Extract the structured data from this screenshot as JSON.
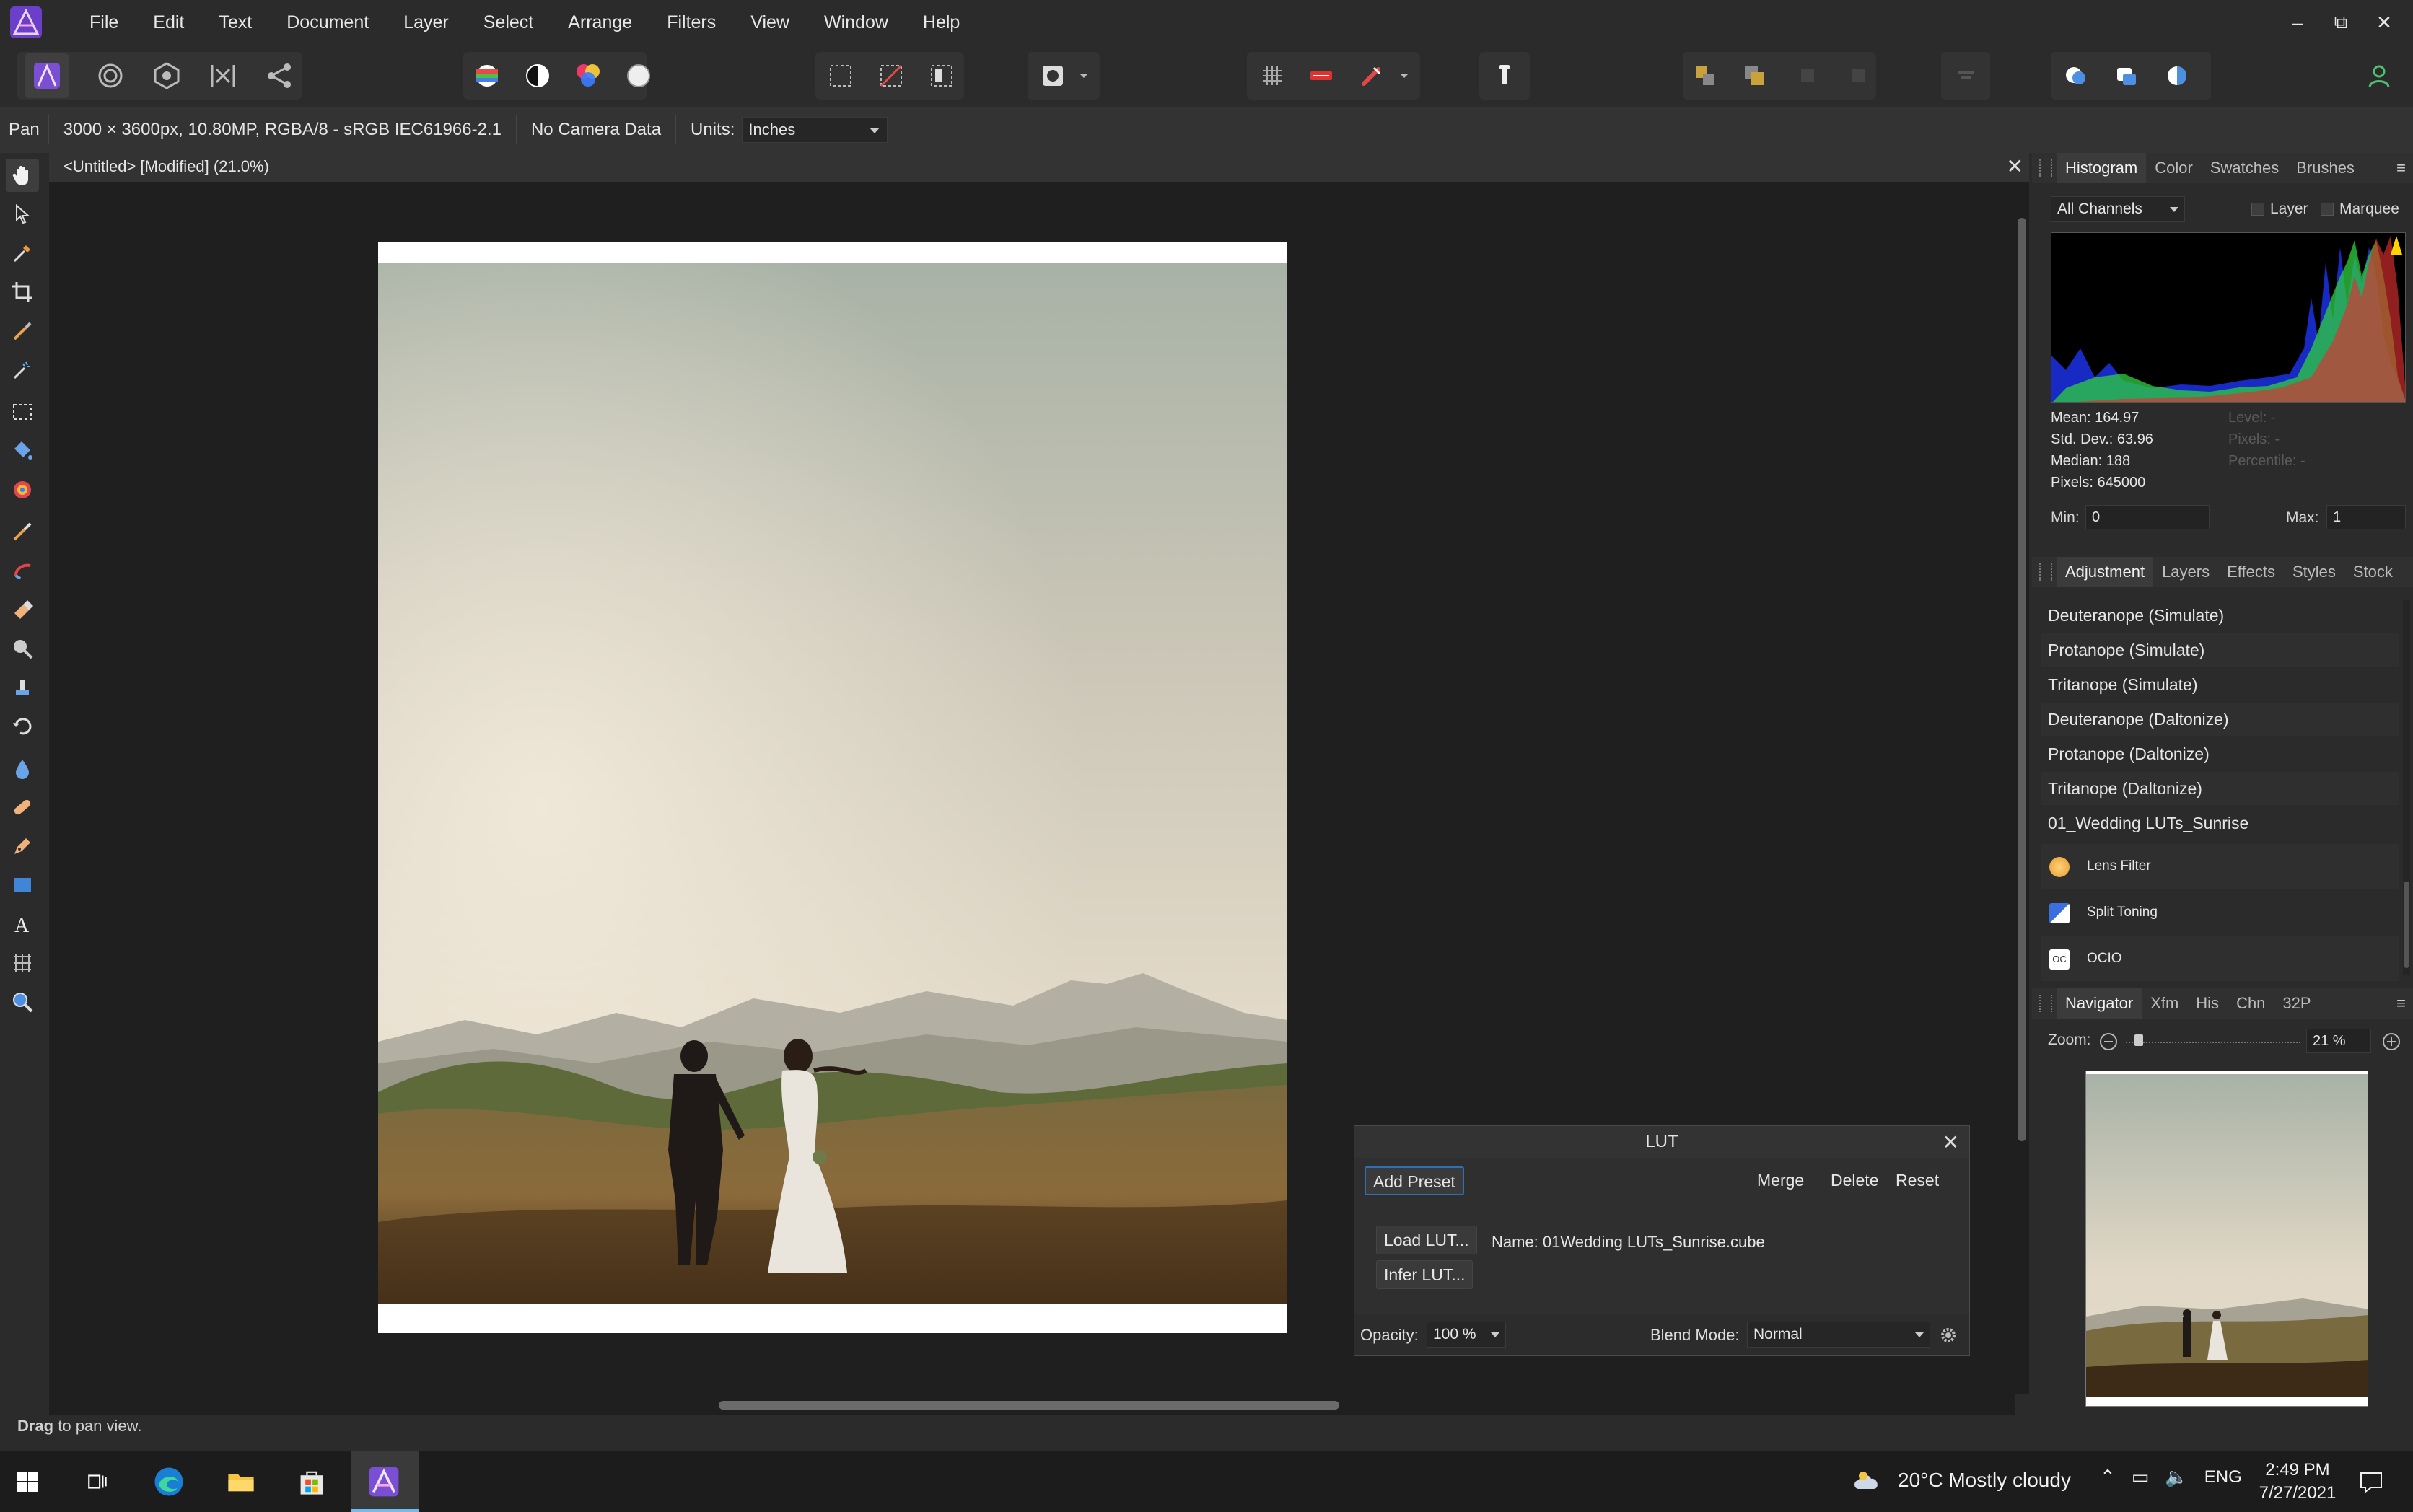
{
  "menu": {
    "items": [
      "File",
      "Edit",
      "Text",
      "Document",
      "Layer",
      "Select",
      "Arrange",
      "Filters",
      "View",
      "Window",
      "Help"
    ],
    "window_controls": {
      "minimize": "–",
      "restore": "⧉",
      "close": "✕"
    }
  },
  "context_bar": {
    "tool": "Pan",
    "doc_info": "3000 × 3600px, 10.80MP, RGBA/8 - sRGB IEC61966-2.1",
    "camera": "No Camera Data",
    "units_label": "Units:",
    "units_value": "Inches"
  },
  "document": {
    "tab_title": "<Untitled> [Modified] (21.0%)",
    "close": "✕"
  },
  "lut": {
    "title": "LUT",
    "add_preset": "Add Preset",
    "merge": "Merge",
    "delete": "Delete",
    "reset": "Reset",
    "load_lut": "Load LUT...",
    "infer_lut": "Infer LUT...",
    "name": "Name: 01Wedding LUTs_Sunrise.cube",
    "opacity_label": "Opacity:",
    "opacity_value": "100 %",
    "blend_label": "Blend Mode:",
    "blend_value": "Normal",
    "close": "✕"
  },
  "histogram_panel": {
    "tabs": [
      "Histogram",
      "Color",
      "Swatches",
      "Brushes"
    ],
    "channel": "All Channels",
    "layer_label": "Layer",
    "marquee_label": "Marquee",
    "mean": "Mean: 164.97",
    "std_dev": "Std. Dev.: 63.96",
    "median": "Median: 188",
    "pixels": "Pixels: 645000",
    "levels_dim": "Level: -",
    "pixels_dim": "Pixels: -",
    "percentile_dim": "Percentile: -",
    "min_label": "Min:",
    "min_value": "0",
    "max_label": "Max:",
    "max_value": "1"
  },
  "adjustment_panel": {
    "tabs": [
      "Adjustment",
      "Layers",
      "Effects",
      "Styles",
      "Stock"
    ],
    "items": [
      "Deuteranope (Simulate)",
      "Protanope (Simulate)",
      "Tritanope (Simulate)",
      "Deuteranope (Daltonize)",
      "Protanope (Daltonize)",
      "Tritanope (Daltonize)",
      "01_Wedding LUTs_Sunrise"
    ],
    "icon_items": [
      "Lens Filter",
      "Split Toning",
      "OCIO"
    ],
    "ocio_icon_text": "OC"
  },
  "navigator_panel": {
    "tabs": [
      "Navigator",
      "Xfm",
      "His",
      "Chn",
      "32P"
    ],
    "zoom_label": "Zoom:",
    "zoom_value": "21 %"
  },
  "status": {
    "bold": "Drag",
    "rest": " to pan view."
  },
  "taskbar": {
    "weather": "20°C  Mostly cloudy",
    "lang": "ENG",
    "time": "2:49 PM",
    "date": "7/27/2021"
  },
  "colors": {
    "accent": "#2f6fb5",
    "app_bg": "#2b2b2b",
    "canvas_bg": "#1f1f1f",
    "affinity_purple": "#7b4fd3"
  }
}
